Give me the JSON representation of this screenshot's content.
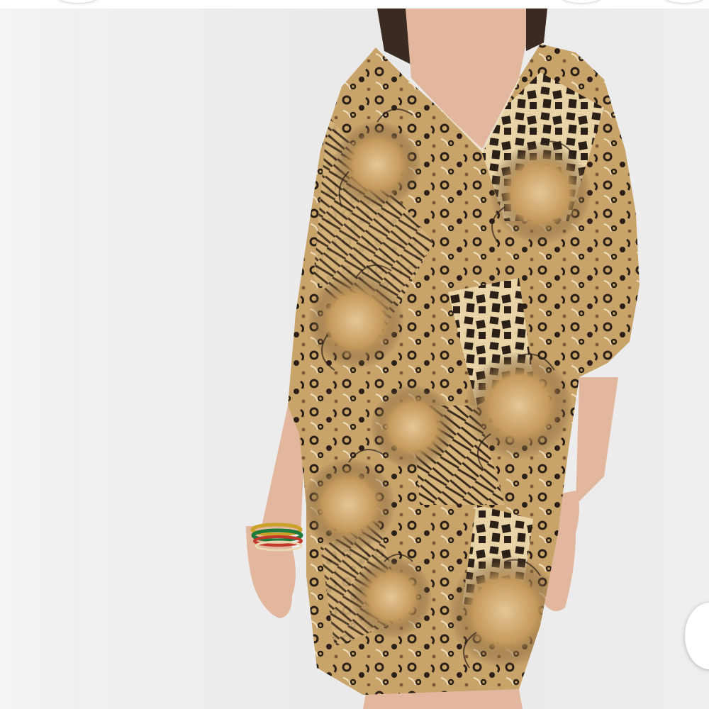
{
  "photo": {
    "subject": "model-wearing-animal-print-dress",
    "background_color": "#ececec",
    "skin_color": "#e2b79e",
    "hair_color": "#3b2a22",
    "dress_base_color": "#c9a46a",
    "print_dark_color": "#2b2018",
    "print_light_color": "#efe0c2"
  },
  "accessories": {
    "bracelet_colors": [
      "#1d7a3a",
      "#c9a227",
      "#c0392b",
      "#e8d9b0"
    ]
  },
  "controls": {
    "carousel_next": "carousel-next-button"
  }
}
